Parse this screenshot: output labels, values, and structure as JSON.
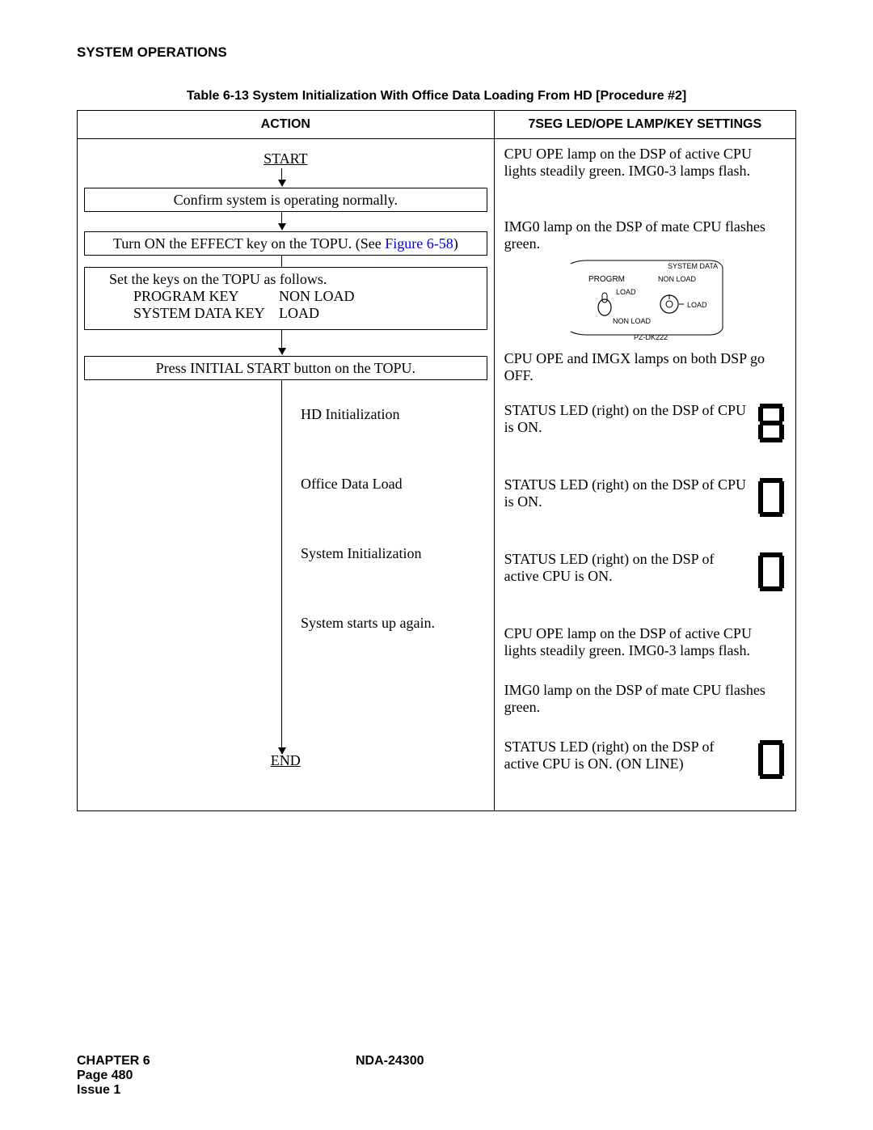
{
  "header": "SYSTEM OPERATIONS",
  "tableCaption": "Table 6-13  System Initialization With Office Data Loading From HD [Procedure #2]",
  "col1": "ACTION",
  "col2": "7SEG LED/OPE LAMP/KEY SETTINGS",
  "flow": {
    "start": "START",
    "s1": "Confirm system is operating normally.",
    "s2a": "Turn ON the EFFECT key on the TOPU. (See ",
    "s2link": "Figure 6-58",
    "s2b": ")",
    "s3head": "Set the keys on the TOPU as follows.",
    "s3k1": "PROGRAM KEY",
    "s3v1": "NON LOAD",
    "s3k2": "SYSTEM DATA KEY",
    "s3v2": "LOAD",
    "s4": "Press INITIAL START button on the TOPU.",
    "hd": "HD Initialization",
    "odl": "Office Data Load",
    "sysinit": "System Initialization",
    "restart": "System starts up again.",
    "end": "END"
  },
  "settings": {
    "p1": "CPU OPE lamp on the DSP of active CPU lights steadily green. IMG0-3 lamps flash.",
    "p2": "IMG0 lamp on the DSP of mate CPU flashes green.",
    "topulabels": {
      "progrm": "PROGRM",
      "load": "LOAD",
      "nonload": "NON LOAD",
      "sysdata": "SYSTEM DATA",
      "part": "PZ-DK222"
    },
    "p3": "CPU OPE and IMGX lamps on both DSP go OFF.",
    "st1": "STATUS LED (right) on the DSP of CPU is ON.",
    "st2": "STATUS LED (right) on the DSP of CPU is ON.",
    "st3": "STATUS LED (right) on the DSP of active CPU is ON.",
    "p4": "CPU OPE lamp on the DSP of active CPU lights steadily green. IMG0-3 lamps flash.",
    "p5": "IMG0 lamp on the DSP of mate CPU flashes green.",
    "st4": "STATUS LED (right) on the DSP of active CPU is ON. (ON LINE)"
  },
  "footer": {
    "chapter": "CHAPTER 6",
    "doc": "NDA-24300",
    "page": "Page 480",
    "issue": "Issue 1"
  }
}
